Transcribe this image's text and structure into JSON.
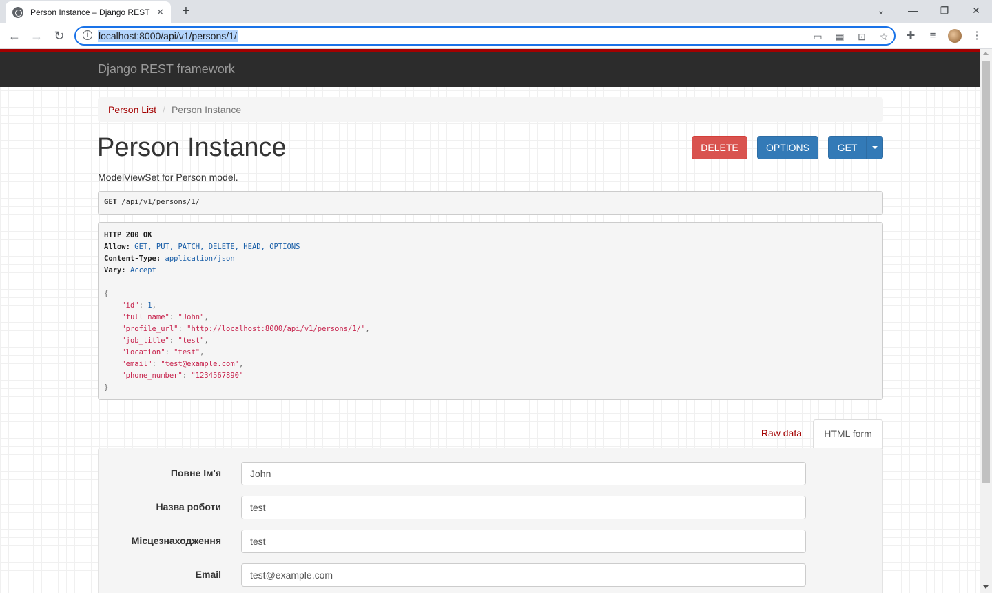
{
  "browser": {
    "tab_title": "Person Instance – Django REST fr",
    "url": "localhost:8000/api/v1/persons/1/"
  },
  "navbar": {
    "brand": "Django REST framework"
  },
  "breadcrumb": {
    "link": "Person List",
    "separator": "/",
    "current": "Person Instance"
  },
  "page": {
    "title": "Person Instance",
    "description": "ModelViewSet for Person model."
  },
  "buttons": {
    "delete": "DELETE",
    "options": "OPTIONS",
    "get": "GET"
  },
  "request": {
    "method": "GET",
    "path": "/api/v1/persons/1/"
  },
  "response": {
    "status": "HTTP 200 OK",
    "allow_label": "Allow:",
    "allow_value": "GET, PUT, PATCH, DELETE, HEAD, OPTIONS",
    "content_type_label": "Content-Type:",
    "content_type_value": "application/json",
    "vary_label": "Vary:",
    "vary_value": "Accept",
    "json_lines": [
      {
        "key": "\"id\"",
        "value": "1",
        "type": "n",
        "comma": ","
      },
      {
        "key": "\"full_name\"",
        "value": "\"John\"",
        "type": "s",
        "comma": ","
      },
      {
        "key": "\"profile_url\"",
        "value": "\"http://localhost:8000/api/v1/persons/1/\"",
        "type": "s",
        "comma": ","
      },
      {
        "key": "\"job_title\"",
        "value": "\"test\"",
        "type": "s",
        "comma": ","
      },
      {
        "key": "\"location\"",
        "value": "\"test\"",
        "type": "s",
        "comma": ","
      },
      {
        "key": "\"email\"",
        "value": "\"test@example.com\"",
        "type": "s",
        "comma": ","
      },
      {
        "key": "\"phone_number\"",
        "value": "\"1234567890\"",
        "type": "s",
        "comma": ""
      }
    ]
  },
  "tabs": {
    "raw": "Raw data",
    "html": "HTML form"
  },
  "form": {
    "fields": [
      {
        "label": "Повне Ім'я",
        "value": "John"
      },
      {
        "label": "Назва роботи",
        "value": "test"
      },
      {
        "label": "Місцезнаходження",
        "value": "test"
      },
      {
        "label": "Email",
        "value": "test@example.com"
      }
    ]
  },
  "colors": {
    "brand_red": "#a30000",
    "delete": "#d9534f",
    "primary": "#337ab7"
  }
}
